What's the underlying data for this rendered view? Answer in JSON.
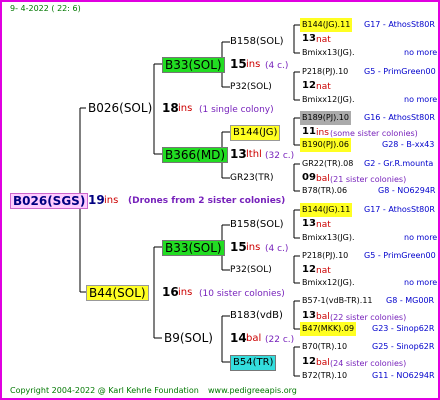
{
  "header": {
    "date": "9-  4-2022 ( 22:  6)"
  },
  "root": {
    "name": "B026(SGS)",
    "gen": "19",
    "unit": "ins",
    "note": "(Drones from 2 sister colonies)"
  },
  "l1": [
    {
      "name": "B026(SOL)",
      "gen": "18",
      "unit": "ins",
      "note": "(1 single colony)"
    },
    {
      "name": "B44(SOL)",
      "gen": "16",
      "unit": "ins",
      "note": "(10 sister colonies)"
    }
  ],
  "l2": [
    {
      "name": "B33(SOL)",
      "gen": "15",
      "unit": "ins",
      "note": "(4 c.)"
    },
    {
      "name": "B366(MD)",
      "gen": "13",
      "unit": "lthl",
      "note": "(32 c.)"
    },
    {
      "name": "B33(SOL)",
      "gen": "15",
      "unit": "ins",
      "note": "(4 c.)"
    },
    {
      "name": "B9(SOL)",
      "gen": "14",
      "unit": "bal",
      "note": "(22 c.)"
    }
  ],
  "l3": [
    {
      "name": "B158(SOL)",
      "gen": "13",
      "unit": "nat",
      "note": ""
    },
    {
      "name": "P32(SOL)",
      "gen": "12",
      "unit": "nat",
      "note": ""
    },
    {
      "name": "B144(JG)",
      "gen": "11",
      "unit": "ins",
      "note": "(some sister colonies)"
    },
    {
      "name": "GR23(TR)",
      "gen": "09",
      "unit": "bal",
      "note": "(21 sister colonies)"
    },
    {
      "name": "B158(SOL)",
      "gen": "13",
      "unit": "nat",
      "note": ""
    },
    {
      "name": "P32(SOL)",
      "gen": "12",
      "unit": "nat",
      "note": ""
    },
    {
      "name": "B183(vdB)",
      "gen": "13",
      "unit": "bal",
      "note": "(22 sister colonies)"
    },
    {
      "name": "B54(TR)",
      "gen": "12",
      "unit": "bal",
      "note": "(24 sister colonies)"
    }
  ],
  "l4": [
    {
      "name": "B144(JG).11",
      "breeder": "G17 - AthosSt80R"
    },
    {
      "name": "Bmixx13(JG).",
      "breeder": "no more"
    },
    {
      "name": "P218(PJ).10",
      "breeder": "G5 - PrimGreen00"
    },
    {
      "name": "Bmixx12(JG).",
      "breeder": "no more"
    },
    {
      "name": "B189(PJ).10",
      "breeder": "G16 - AthosSt80R"
    },
    {
      "name": "B190(PJ).06",
      "breeder": "G28 - B-xx43"
    },
    {
      "name": "GR22(TR).08",
      "breeder": "G2 - Gr.R.mounta"
    },
    {
      "name": "B78(TR).06",
      "breeder": "G8 - NO6294R"
    },
    {
      "name": "B144(JG).11",
      "breeder": "G17 - AthosSt80R"
    },
    {
      "name": "Bmixx13(JG).",
      "breeder": "no more"
    },
    {
      "name": "P218(PJ).10",
      "breeder": "G5 - PrimGreen00"
    },
    {
      "name": "Bmixx12(JG).",
      "breeder": "no more"
    },
    {
      "name": "B57-1(vdB-TR).11",
      "breeder": "G8 - MG00R"
    },
    {
      "name": "B47(MKK).09",
      "breeder": "G23 - Sinop62R"
    },
    {
      "name": "B70(TR).10",
      "breeder": "G25 - Sinop62R"
    },
    {
      "name": "B72(TR).10",
      "breeder": "G11 - NO6294R"
    }
  ],
  "footer": {
    "copyright": "Copyright 2004-2022 @ Karl Kehrle Foundation",
    "site": "www.pedigreeapis.org"
  },
  "colors": {
    "border": "#e000e0",
    "root_bg": "#ffccff",
    "yellow": "#ffff22",
    "green": "#22dd22",
    "cyan": "#33dddd",
    "gray": "#aaaaaa",
    "line": "#000000"
  }
}
